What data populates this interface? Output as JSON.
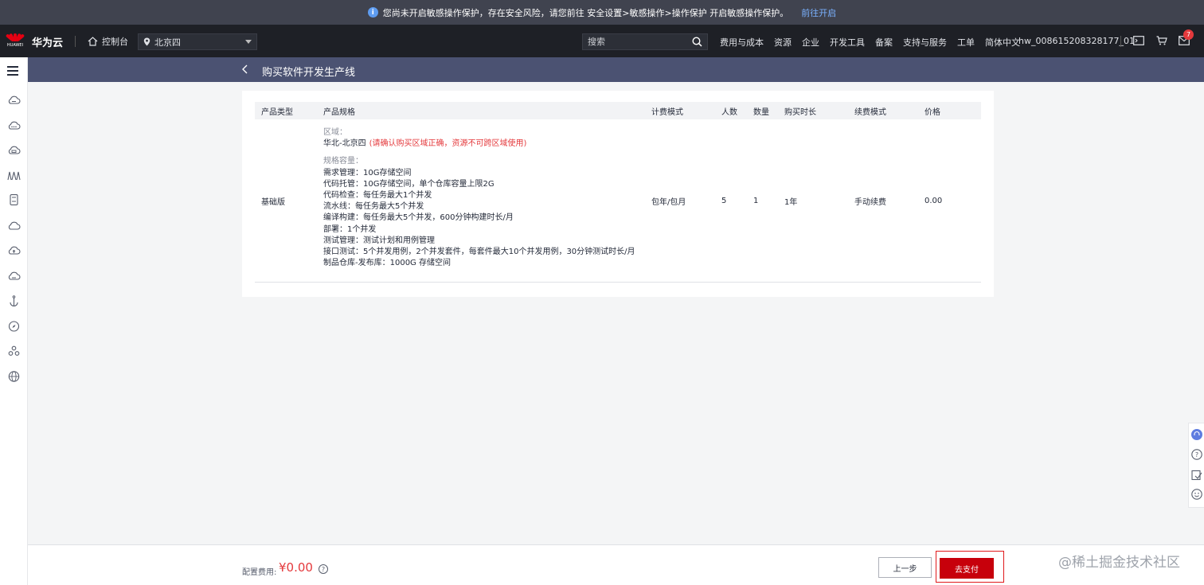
{
  "notice": {
    "text": "您尚未开启敏感操作保护，存在安全风险，请您前往 安全设置>敏感操作>操作保护 开启敏感操作保护。",
    "link": "前往开启"
  },
  "topnav": {
    "logo_text": "HUAWEI",
    "brand": "华为云",
    "console": "控制台",
    "region": "北京四",
    "search_placeholder": "搜索",
    "links": [
      "费用与成本",
      "资源",
      "企业",
      "开发工具",
      "备案",
      "支持与服务",
      "工单",
      "简体中文"
    ],
    "account": "hw_008615208328177_01",
    "message_count": "7"
  },
  "page": {
    "title": "购买软件开发生产线"
  },
  "table": {
    "headers": [
      "产品类型",
      "产品规格",
      "计费模式",
      "人数",
      "数量",
      "购买时长",
      "续费模式",
      "价格"
    ],
    "row": {
      "type": "基础版",
      "region_label": "区域：",
      "region_value": "华北-北京四",
      "region_warning": "(请确认购买区域正确，资源不可跨区域使用)",
      "capacity_label": "规格容量：",
      "specs": [
        "需求管理：10G存储空间",
        "代码托管：10G存储空间，单个仓库容量上限2G",
        "代码检查：每任务最大1个并发",
        "流水线：每任务最大5个并发",
        "编译构建：每任务最大5个并发，600分钟构建时长/月",
        "部署：1个并发",
        "测试管理：测试计划和用例管理",
        "接口测试：5个并发用例，2个并发套件，每套件最大10个并发用例，30分钟测试时长/月",
        "制品仓库-发布库：1000G 存储空间"
      ],
      "billing": "包年/包月",
      "users": "5",
      "quantity": "1",
      "duration": "1年",
      "renewal": "手动续费",
      "price": "0.00"
    }
  },
  "footer": {
    "fee_label": "配置费用:",
    "fee_value": "¥0.00",
    "prev_button": "上一步",
    "pay_button": "去支付"
  },
  "watermark": "@稀土掘金技术社区",
  "colors": {
    "accent_red": "#c7000b",
    "warning_red": "#e4393c",
    "header_bg": "#4b5272",
    "nav_bg": "#1e2026"
  }
}
